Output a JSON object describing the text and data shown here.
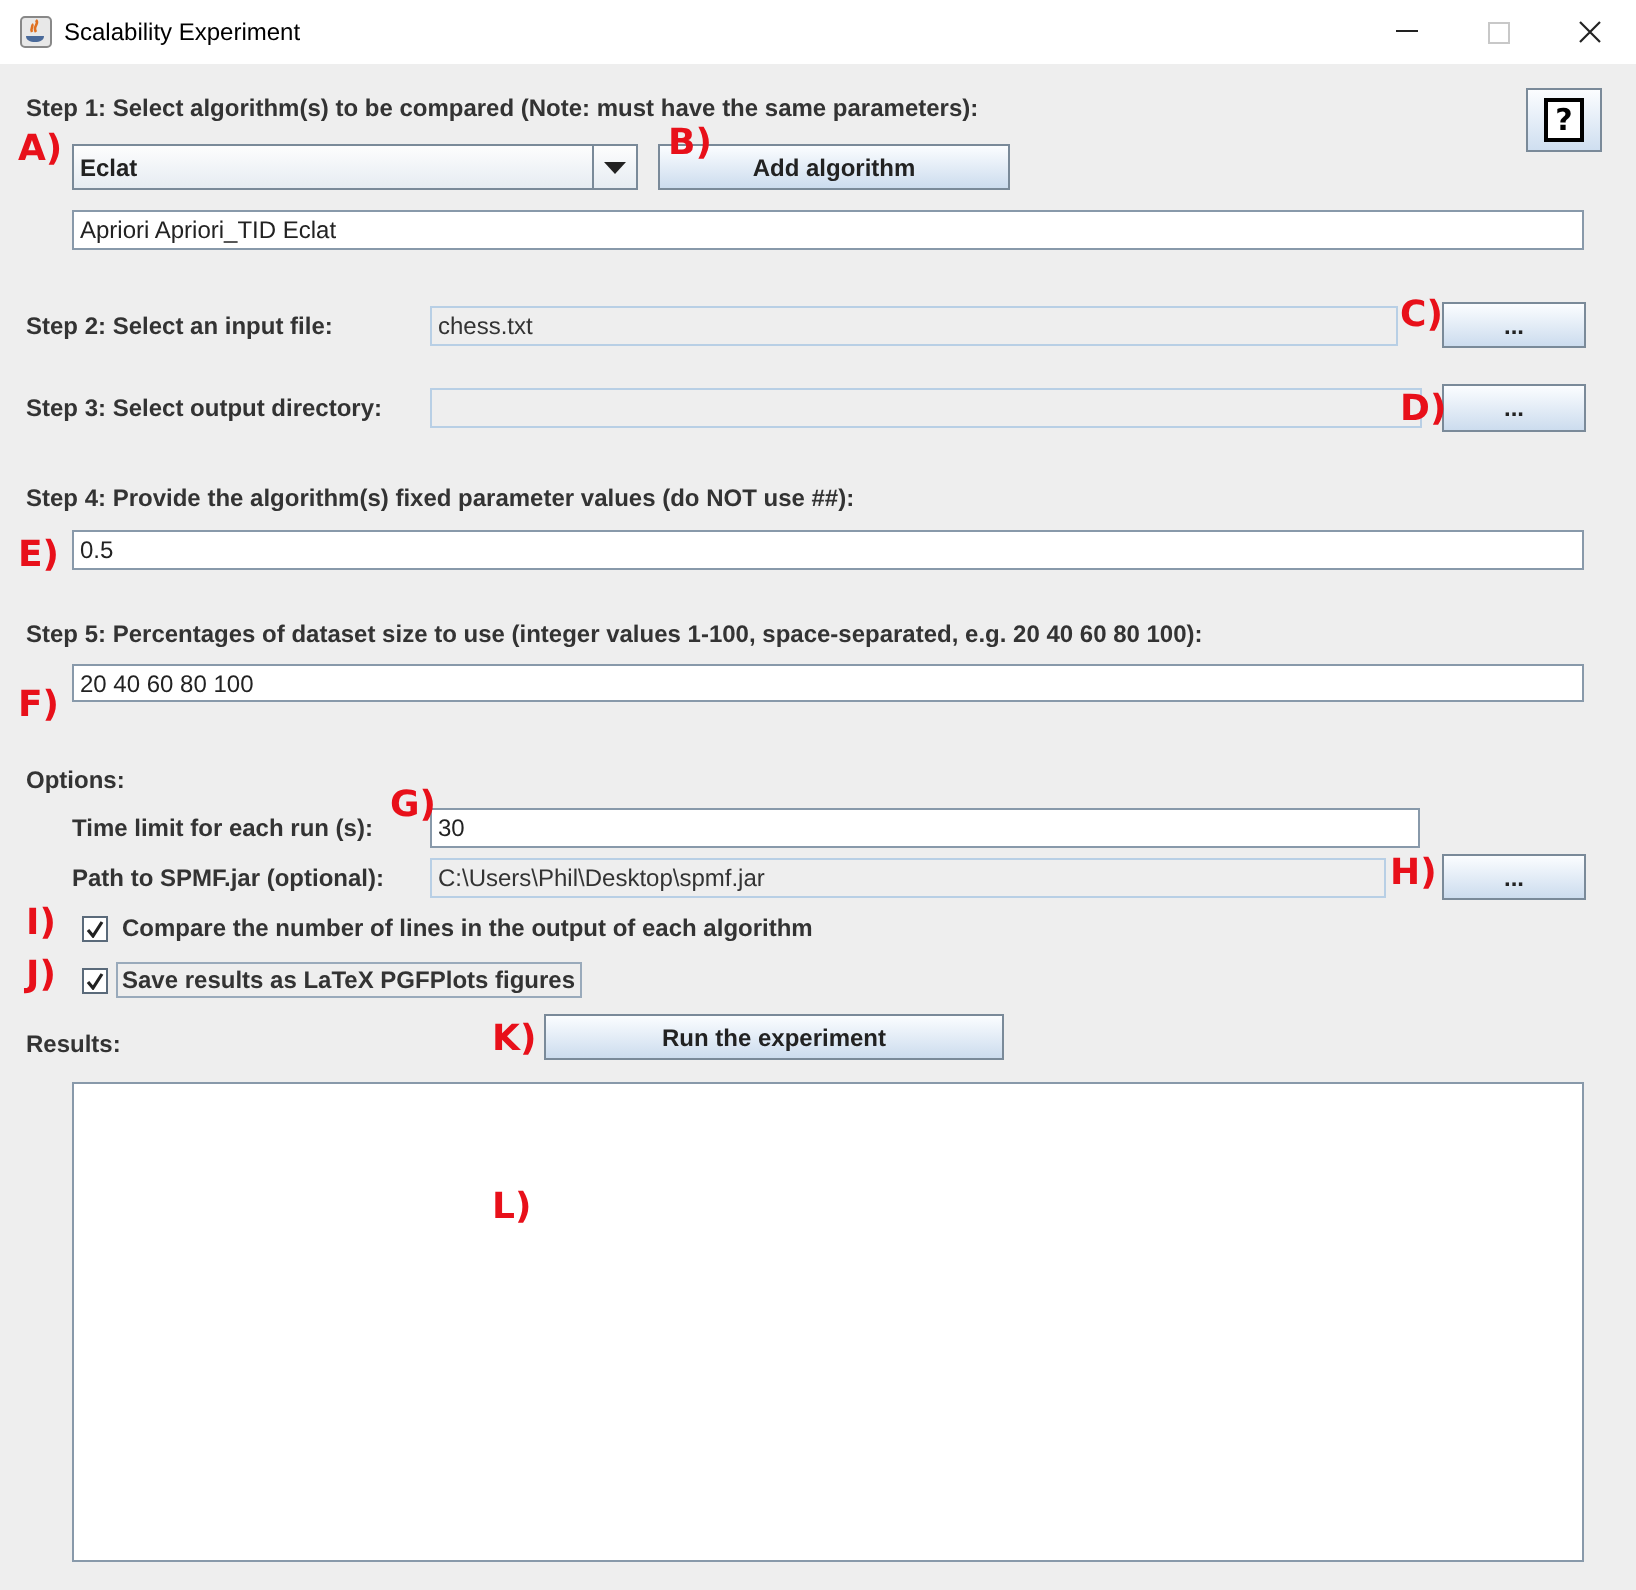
{
  "window": {
    "title": "Scalability Experiment",
    "maximize_disabled": true
  },
  "help_button": "?",
  "step1": {
    "label": "Step 1: Select algorithm(s) to be compared (Note: must have the same parameters):",
    "algorithm_select": "Eclat",
    "add_button": "Add algorithm",
    "selected_algorithms": "Apriori Apriori_TID Eclat"
  },
  "step2": {
    "label": "Step 2: Select an input file:",
    "value": "chess.txt",
    "editable": false,
    "browse_button": "..."
  },
  "step3": {
    "label": "Step 3: Select output directory:",
    "editable": false,
    "browse_button": "..."
  },
  "step4": {
    "label": "Step 4: Provide the algorithm(s) fixed parameter values (do NOT use ##):",
    "value": "0.5",
    "editable": true
  },
  "step5": {
    "label": "Step 5: Percentages of dataset size to use (integer values 1-100, space-separated, e.g. 20 40 60 80 100):",
    "value": "20 40 60 80 100",
    "editable": true
  },
  "options": {
    "heading": "Options:",
    "time_limit": {
      "label": "Time limit for each run (s):",
      "value": "30",
      "editable": true
    },
    "spmf_path": {
      "label": "Path to SPMF.jar (optional):",
      "value": "C:\\Users\\Phil\\Desktop\\spmf.jar",
      "editable": false,
      "browse_button": "..."
    },
    "checkboxes": [
      {
        "label": "Compare the number of lines in the output of each algorithm",
        "checked": true,
        "focused": false
      },
      {
        "label": "Save results as LaTeX PGFPlots figures",
        "checked": true,
        "focused": true
      }
    ]
  },
  "results": {
    "label": "Results:",
    "run_button": "Run the experiment"
  },
  "annotations": [
    {
      "label": "A)"
    },
    {
      "label": "B)"
    },
    {
      "label": "C)"
    },
    {
      "label": "D)"
    },
    {
      "label": "E)"
    },
    {
      "label": "F)"
    },
    {
      "label": "G)"
    },
    {
      "label": "H)"
    },
    {
      "label": "I)"
    },
    {
      "label": "J)"
    },
    {
      "label": "K)"
    },
    {
      "label": "L)"
    }
  ]
}
